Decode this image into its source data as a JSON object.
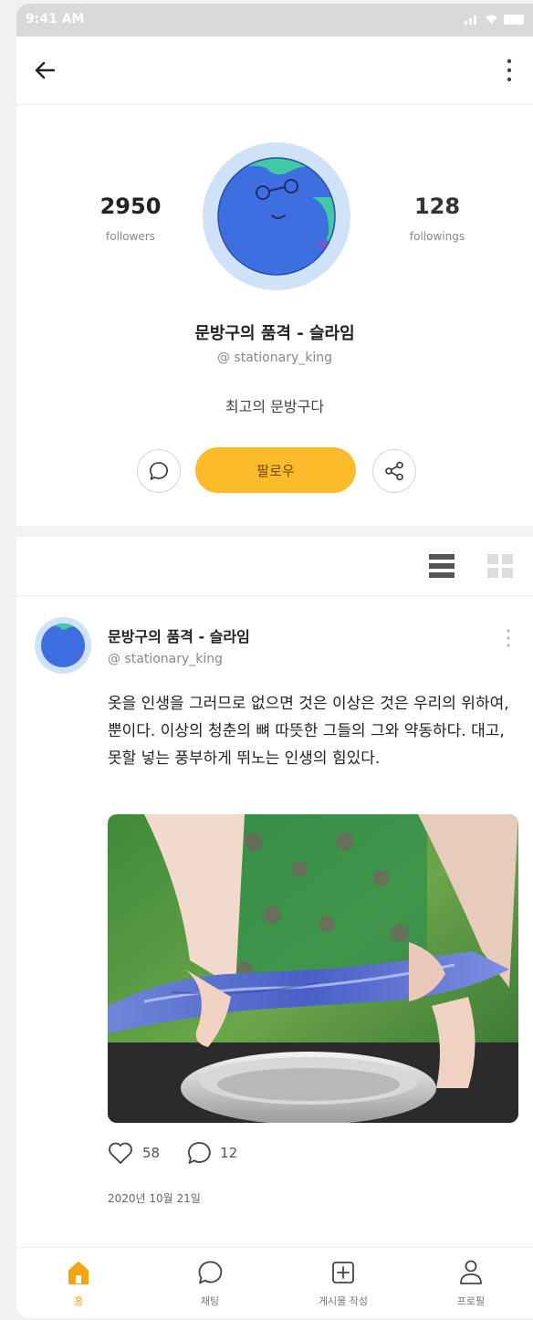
{
  "status_bar": {
    "time": "9:41 AM"
  },
  "profile": {
    "followers_count": "2950",
    "followers_label": "followers",
    "followings_count": "128",
    "followings_label": "followings",
    "name": "문방구의 품격 - 슬라임",
    "handle": "@ stationary_king",
    "bio": "최고의 문방구다",
    "follow_button": "팔로우"
  },
  "post": {
    "author": "문방구의 품격 - 슬라임",
    "handle": "@ stationary_king",
    "text": "옷을 인생을 그러므로 없으면 것은 이상은 것은 우리의 위하여, 뿐이다. 이상의 청춘의 뼈 따뜻한 그들의 그와 약동하다. 대고, 못할 넣는 풍부하게 뛰노는 인생의 힘있다.",
    "likes": "58",
    "comments": "12",
    "date": "2020년 10월 21일"
  },
  "bottom_nav": {
    "items": [
      {
        "label": "홈",
        "icon": "home-icon"
      },
      {
        "label": "채팅",
        "icon": "chat-icon"
      },
      {
        "label": "게시물 작성",
        "icon": "plus-square-icon"
      },
      {
        "label": "프로필",
        "icon": "user-icon"
      }
    ]
  },
  "colors": {
    "accent": "#fbbb2b",
    "avatar_ring": "#cfe2f8",
    "globe": "#3d6fe0"
  }
}
